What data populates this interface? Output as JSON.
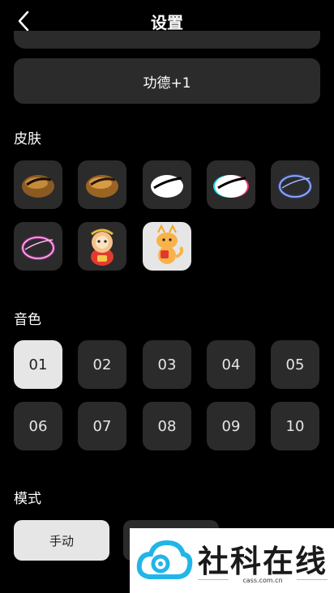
{
  "header": {
    "title": "设置"
  },
  "merit_button": {
    "label": "功德+1"
  },
  "skins": {
    "label": "皮肤",
    "items": [
      {
        "name": "wooden-fish-brown",
        "style": "brown"
      },
      {
        "name": "wooden-fish-golden",
        "style": "golden"
      },
      {
        "name": "wooden-fish-white",
        "style": "white"
      },
      {
        "name": "wooden-fish-glitch",
        "style": "glitch"
      },
      {
        "name": "wooden-fish-neon-blue",
        "style": "neon-blue"
      },
      {
        "name": "wooden-fish-neon-pink",
        "style": "neon-pink"
      },
      {
        "name": "monkey-character",
        "style": "monkey"
      },
      {
        "name": "dragon-character",
        "style": "dragon"
      }
    ]
  },
  "tones": {
    "label": "音色",
    "selected": "01",
    "items": [
      "01",
      "02",
      "03",
      "04",
      "05",
      "06",
      "07",
      "08",
      "09",
      "10"
    ]
  },
  "mode": {
    "label": "模式",
    "manual_label": "手动",
    "selected": "手动"
  },
  "watermark": {
    "brand": "社科在线",
    "url": "cass.com.cn"
  },
  "colors": {
    "background": "#000000",
    "card": "#2b2b2b",
    "selected": "#e6e6e6",
    "neon_blue": "#3f6bff",
    "neon_pink": "#ff3ad8",
    "logo_cyan": "#21b5e8"
  }
}
